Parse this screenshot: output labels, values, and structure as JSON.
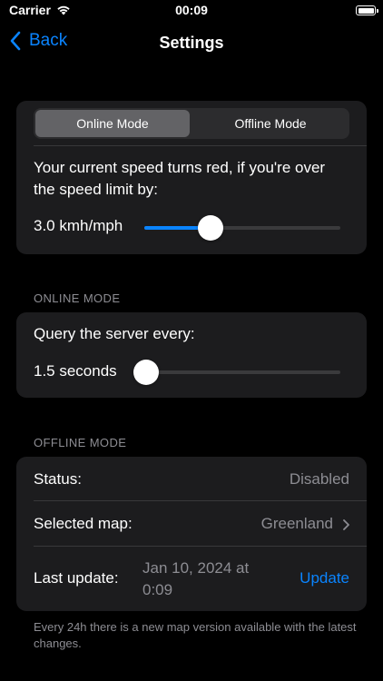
{
  "status_bar": {
    "carrier": "Carrier",
    "time": "00:09"
  },
  "nav": {
    "back_label": "Back",
    "title": "Settings"
  },
  "mode_card": {
    "segments": [
      "Online Mode",
      "Offline Mode"
    ],
    "selected_segment": "Online Mode",
    "description": "Your current speed turns red, if you're over the speed limit by:",
    "slider_value_label": "3.0 kmh/mph",
    "slider_fraction": 0.34
  },
  "online_section": {
    "header": "ONLINE MODE",
    "description": "Query the server every:",
    "slider_value_label": "1.5 seconds",
    "slider_fraction": 0.0
  },
  "offline_section": {
    "header": "OFFLINE MODE",
    "status_label": "Status:",
    "status_value": "Disabled",
    "map_label": "Selected map:",
    "map_value": "Greenland",
    "update_label": "Last update:",
    "update_value_line1": "Jan 10, 2024 at",
    "update_value_line2": "0:09",
    "update_button": "Update",
    "footer": "Every 24h there is a new map version available with the latest changes."
  },
  "colors": {
    "accent": "#0a84ff",
    "card": "#1c1c1e",
    "secondary_text": "#8d8d93"
  }
}
